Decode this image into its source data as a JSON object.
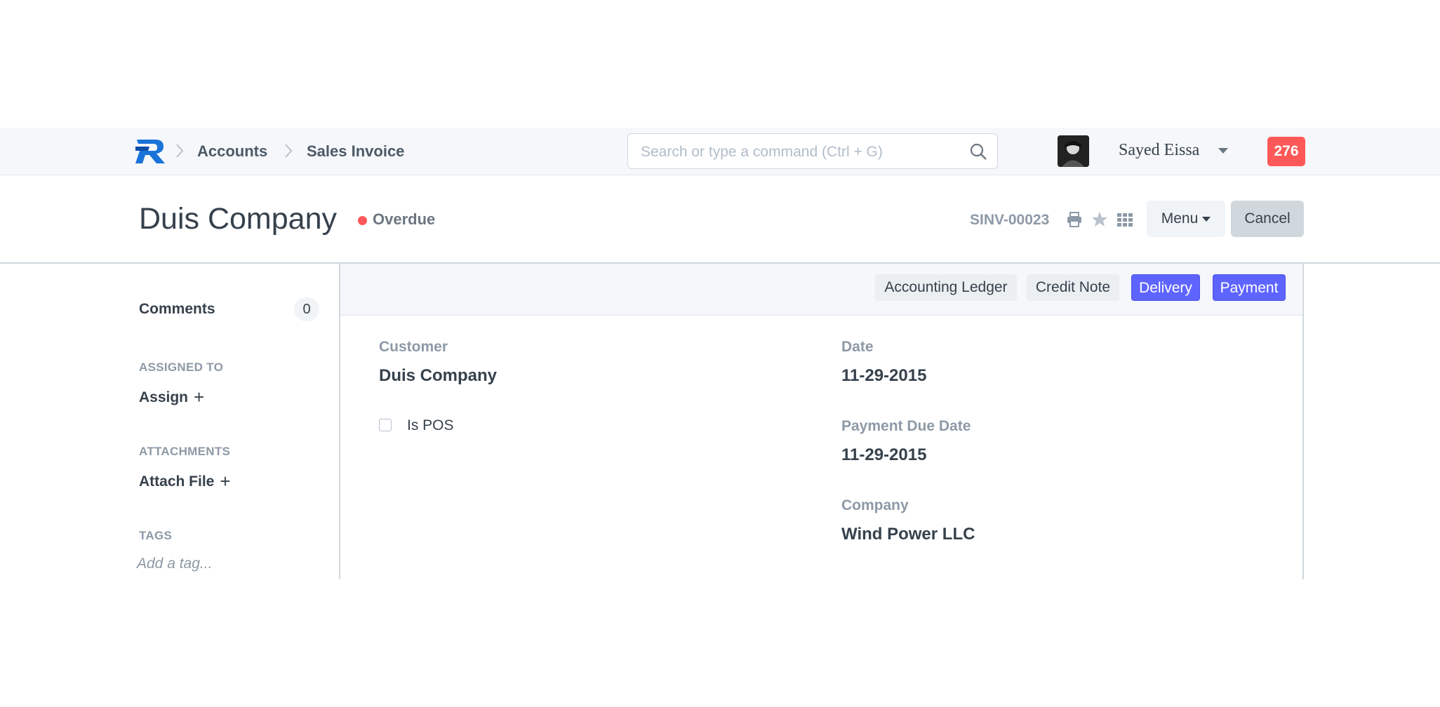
{
  "navbar": {
    "breadcrumbs": [
      "Accounts",
      "Sales Invoice"
    ],
    "search_placeholder": "Search or type a command (Ctrl + G)",
    "user_name": "Sayed Eissa",
    "notification_count": "276"
  },
  "page_head": {
    "title": "Duis Company",
    "status": "Overdue",
    "status_color": "#ff5858",
    "doc_name": "SINV-00023",
    "menu_label": "Menu",
    "cancel_label": "Cancel"
  },
  "sidebar": {
    "comments_label": "Comments",
    "comments_count": "0",
    "assigned_to_label": "ASSIGNED TO",
    "assign_link": "Assign",
    "attachments_label": "ATTACHMENTS",
    "attach_link": "Attach File",
    "tags_label": "TAGS",
    "tag_placeholder": "Add a tag..."
  },
  "toolbar": {
    "buttons": [
      "Accounting Ledger",
      "Credit Note",
      "Delivery",
      "Payment"
    ],
    "primary_color": "#5e64ff"
  },
  "form": {
    "customer_label": "Customer",
    "customer_value": "Duis Company",
    "is_pos_label": "Is POS",
    "date_label": "Date",
    "date_value": "11-29-2015",
    "due_date_label": "Payment Due Date",
    "due_date_value": "11-29-2015",
    "company_label": "Company",
    "company_value": "Wind Power LLC"
  }
}
